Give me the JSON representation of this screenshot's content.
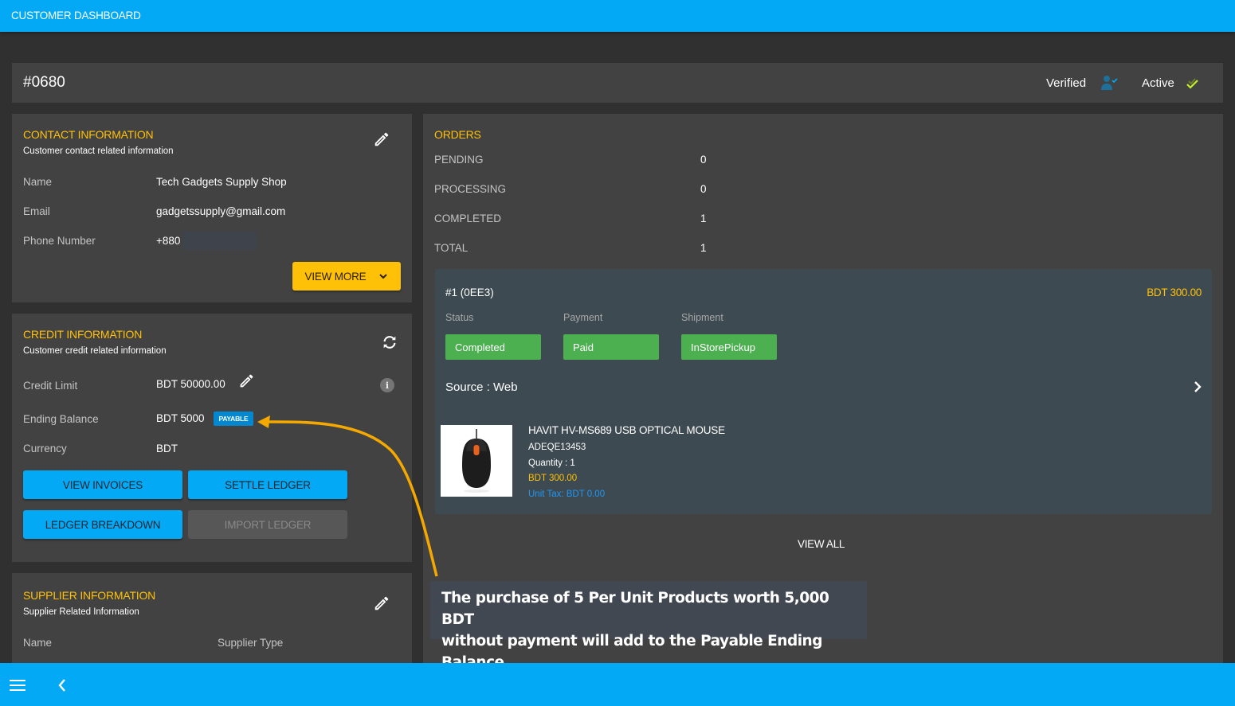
{
  "app": {
    "title": "CUSTOMER DASHBOARD"
  },
  "customer_header": {
    "id": "#0680",
    "verified_label": "Verified",
    "verified_icon": "user-check-icon",
    "active_label": "Active",
    "active_icon": "double-check-icon"
  },
  "contact": {
    "title": "CONTACT INFORMATION",
    "subtitle": "Customer contact related information",
    "edit_icon": "pencil-icon",
    "rows": [
      {
        "label": "Name",
        "value": "Tech Gadgets Supply Shop"
      },
      {
        "label": "Email",
        "value": "gadgetssupply@gmail.com"
      },
      {
        "label": "Phone Number",
        "value": "+880"
      }
    ],
    "view_more_label": "VIEW MORE"
  },
  "credit": {
    "title": "CREDIT INFORMATION",
    "subtitle": "Customer credit related information",
    "refresh_icon": "sync-icon",
    "rows": [
      {
        "label": "Credit Limit",
        "value": "BDT 50000.00"
      },
      {
        "label": "Ending Balance",
        "value": "BDT 5000",
        "badge": "PAYABLE"
      },
      {
        "label": "Currency",
        "value": "BDT"
      }
    ],
    "info_glyph": "i",
    "buttons": {
      "view_invoices": "VIEW INVOICES",
      "settle_ledger": "SETTLE LEDGER",
      "ledger_breakdown": "LEDGER BREAKDOWN",
      "import_ledger": "IMPORT LEDGER"
    }
  },
  "supplier": {
    "title": "SUPPLIER INFORMATION",
    "subtitle": "Supplier Related Information",
    "columns": [
      "Name",
      "Supplier Type"
    ]
  },
  "orders": {
    "title": "ORDERS",
    "stats": [
      {
        "label": "PENDING",
        "value": "0"
      },
      {
        "label": "PROCESSING",
        "value": "0"
      },
      {
        "label": "COMPLETED",
        "value": "1"
      },
      {
        "label": "TOTAL",
        "value": "1"
      }
    ],
    "order": {
      "id": "#1 (0EE3)",
      "total": "BDT 300.00",
      "status_label": "Status",
      "status": "Completed",
      "payment_label": "Payment",
      "payment": "Paid",
      "shipment_label": "Shipment",
      "shipment": "InStorePickup",
      "source": "Source : Web",
      "item": {
        "name": "HAVIT HV-MS689 USB OPTICAL MOUSE",
        "sku": "ADEQE13453",
        "quantity": "Quantity : 1",
        "price": "BDT 300.00",
        "unit_tax": "Unit Tax: BDT 0.00"
      }
    },
    "view_all_label": "VIEW ALL"
  },
  "annotation": {
    "line1": "The purchase of 5 Per Unit Products worth 5,000 BDT",
    "line2": "without payment will add to the Payable Ending Balance"
  },
  "colors": {
    "primary": "#03a9f4",
    "accent": "#ffc107",
    "success": "#4caf50",
    "badge": "#0288d1",
    "card": "#424242",
    "background": "#303030"
  }
}
